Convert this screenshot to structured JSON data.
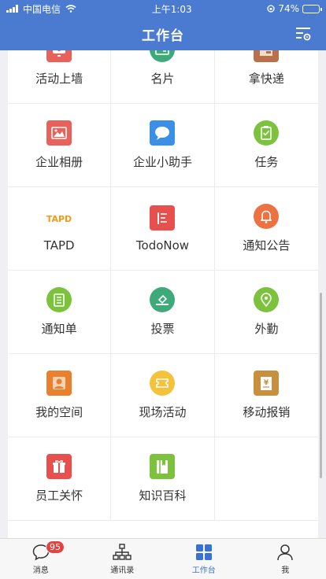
{
  "status": {
    "carrier": "中国电信",
    "time": "上午1:03",
    "battery": "74%",
    "battery_level": 0.74
  },
  "header": {
    "title": "工作台"
  },
  "apps": [
    {
      "label": "活动上墙",
      "icon": "activity-wall-icon",
      "color": "#e8615a"
    },
    {
      "label": "名片",
      "icon": "business-card-icon",
      "color": "#3eaa7a"
    },
    {
      "label": "拿快递",
      "icon": "package-icon",
      "color": "#b8714a"
    },
    {
      "label": "企业相册",
      "icon": "photo-album-icon",
      "color": "#e8615a"
    },
    {
      "label": "企业小助手",
      "icon": "chat-assistant-icon",
      "color": "#3b8fe6"
    },
    {
      "label": "任务",
      "icon": "task-clipboard-icon",
      "color": "#7cc23d"
    },
    {
      "label": "TAPD",
      "icon": "tapd-logo-icon",
      "color": "#f39a1a"
    },
    {
      "label": "TodoNow",
      "icon": "todonow-icon",
      "color": "#e8504d"
    },
    {
      "label": "通知公告",
      "icon": "bell-icon",
      "color": "#ee7141"
    },
    {
      "label": "通知单",
      "icon": "notice-list-icon",
      "color": "#7cc23d"
    },
    {
      "label": "投票",
      "icon": "vote-icon",
      "color": "#3eaa7a"
    },
    {
      "label": "外勤",
      "icon": "location-pin-icon",
      "color": "#7cc23d"
    },
    {
      "label": "我的空间",
      "icon": "my-space-icon",
      "color": "#e8802e"
    },
    {
      "label": "现场活动",
      "icon": "ticket-icon",
      "color": "#f4c23b"
    },
    {
      "label": "移动报销",
      "icon": "reimbursement-icon",
      "color": "#c88f3f"
    },
    {
      "label": "员工关怀",
      "icon": "gift-icon",
      "color": "#e8504d"
    },
    {
      "label": "知识百科",
      "icon": "knowledge-book-icon",
      "color": "#7cc23d"
    },
    {
      "label": "",
      "icon": "",
      "color": ""
    }
  ],
  "tabs": [
    {
      "label": "消息",
      "icon": "message-bubble-icon",
      "badge": "95"
    },
    {
      "label": "通讯录",
      "icon": "org-chart-icon"
    },
    {
      "label": "工作台",
      "icon": "workbench-grid-icon",
      "active": true
    },
    {
      "label": "我",
      "icon": "person-icon"
    }
  ]
}
